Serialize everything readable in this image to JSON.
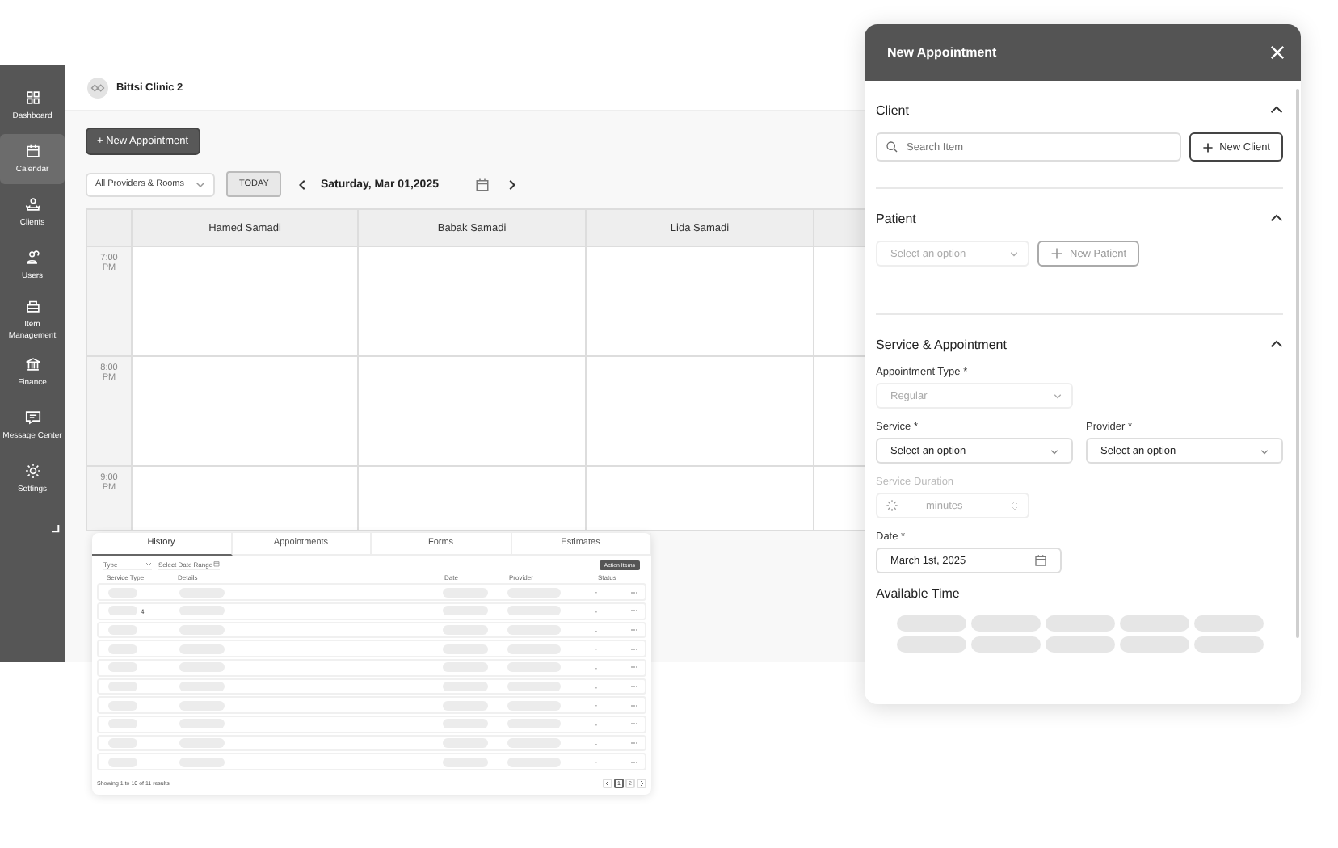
{
  "sidebar": {
    "items": [
      {
        "label": "Dashboard",
        "selected": false
      },
      {
        "label": "Calendar",
        "selected": true
      },
      {
        "label": "Clients",
        "selected": false
      },
      {
        "label": "Users",
        "selected": false
      },
      {
        "label": "Item Management",
        "selected": false
      },
      {
        "label": "Finance",
        "selected": false
      },
      {
        "label": "Message Center",
        "selected": false
      },
      {
        "label": "Settings",
        "selected": false
      }
    ]
  },
  "header": {
    "clinic": "Bittsi Clinic 2"
  },
  "toolbar": {
    "new_button": "+ New Appointment",
    "filter": "All Providers & Rooms",
    "today": "TODAY",
    "date": "Saturday, Mar 01,2025"
  },
  "calendar": {
    "columns": [
      "Hamed Samadi",
      "Babak Samadi",
      "Lida Samadi"
    ],
    "times": [
      "7:00 PM",
      "8:00 PM",
      "9:00 PM"
    ]
  },
  "history": {
    "tabs": [
      {
        "label": "History",
        "selected": true
      },
      {
        "label": "Appointments",
        "selected": false
      },
      {
        "label": "Forms",
        "selected": false
      },
      {
        "label": "Estimates",
        "selected": false
      }
    ],
    "type_filter": "Type",
    "date_filter": "Select Date Range",
    "action_button": "Action Items",
    "columns": [
      "Service Type",
      "Details",
      "Date",
      "Provider",
      "Status"
    ],
    "rows": [
      {
        "status": "-"
      },
      {
        "status": "-",
        "count": "4"
      },
      {
        "status": "-"
      },
      {
        "status": "-"
      },
      {
        "status": "-"
      },
      {
        "status": "-"
      },
      {
        "status": "-"
      },
      {
        "status": "-"
      },
      {
        "status": "-"
      },
      {
        "status": "-"
      }
    ],
    "footer": "Showing 1 to 10 of 11 results",
    "pages": [
      {
        "label": "1",
        "selected": true
      },
      {
        "label": "2",
        "selected": false
      }
    ]
  },
  "modal": {
    "title": "New Appointment",
    "client": {
      "heading": "Client",
      "expanded": true,
      "placeholder": "Search Item",
      "new_button": "New Client"
    },
    "patient": {
      "heading": "Patient",
      "expanded": true,
      "placeholder": "Select an option",
      "disabled": true,
      "new_button": "New Patient"
    },
    "service": {
      "heading": "Service & Appointment",
      "expanded": true,
      "appointment_type": {
        "label": "Appointment Type *",
        "placeholder": "Regular",
        "disabled": true
      },
      "service": {
        "label": "Service *",
        "value": "Select an option"
      },
      "provider": {
        "label": "Provider *",
        "value": "Select an option"
      },
      "duration": {
        "label": "Service Duration",
        "placeholder": "minutes",
        "disabled": true
      },
      "date": {
        "label": "Date *",
        "value": "March 1st, 2025"
      },
      "available_time": "Available Time"
    }
  }
}
